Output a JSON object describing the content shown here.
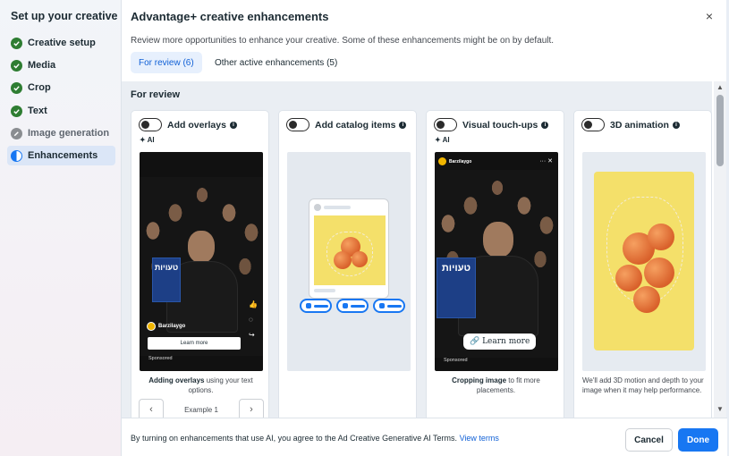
{
  "sidebar": {
    "title": "Set up your creative",
    "steps": [
      {
        "label": "Creative setup",
        "state": "done"
      },
      {
        "label": "Media",
        "state": "done"
      },
      {
        "label": "Crop",
        "state": "done"
      },
      {
        "label": "Text",
        "state": "done"
      },
      {
        "label": "Image generation",
        "state": "pending"
      },
      {
        "label": "Enhancements",
        "state": "active"
      }
    ]
  },
  "modal": {
    "title": "Advantage+ creative enhancements",
    "close_icon": "×",
    "subtitle": "Review more opportunities to enhance your creative. Some of these enhancements might be on by default.",
    "tabs": [
      {
        "label": "For review (6)",
        "active": true
      },
      {
        "label": "Other active enhancements (5)",
        "active": false
      }
    ],
    "section_heading": "For review"
  },
  "cards": [
    {
      "title": "Add overlays",
      "ai_badge": "AI",
      "book_text": "טעויות",
      "brand": "Barzilaygo",
      "cta": "Learn more",
      "sponsored": "Sponsored",
      "caption_bold": "Adding overlays",
      "caption_rest": " using your text options.",
      "pager_label": "Example 1",
      "prev_icon": "‹",
      "next_icon": "›"
    },
    {
      "title": "Add catalog items"
    },
    {
      "title": "Visual touch-ups",
      "ai_badge": "AI",
      "book_text": "טעויות",
      "brand": "Barzilaygo",
      "cta": "Learn more",
      "sponsored": "Sponsored",
      "caption_bold": "Cropping image",
      "caption_rest": " to fit more placements."
    },
    {
      "title": "3D animation",
      "caption": "We'll add 3D motion and depth to your image when it may help performance."
    }
  ],
  "footer": {
    "consent_text": "By turning on enhancements that use AI, you agree to the Ad Creative Generative AI Terms.",
    "consent_link": "View terms",
    "cancel_label": "Cancel",
    "done_label": "Done"
  },
  "colors": {
    "accent": "#1877f2",
    "done_green": "#2e7d32",
    "book_blue": "#1d3f86",
    "fruit_yellow": "#f4e06a"
  },
  "icons": {
    "check": "check-icon",
    "info": "info-icon",
    "sparkle": "sparkle-icon",
    "close": "close-icon"
  }
}
